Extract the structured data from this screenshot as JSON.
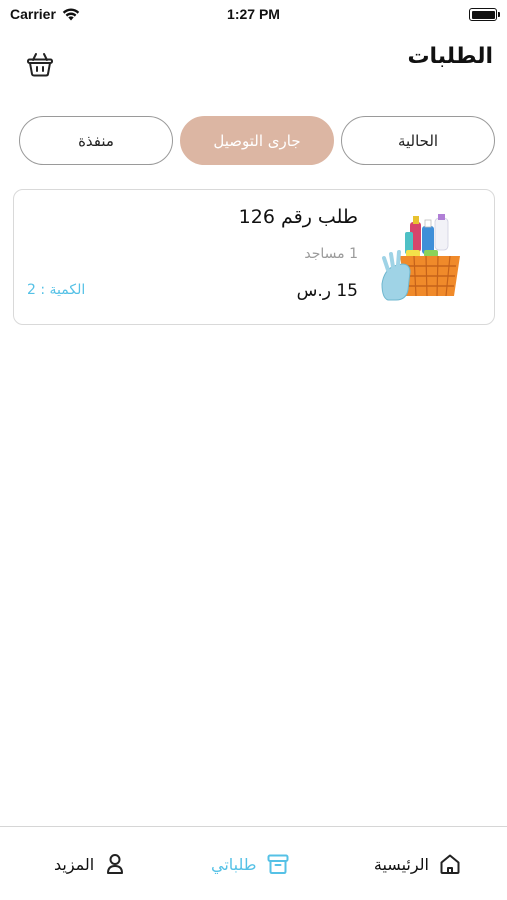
{
  "status_bar": {
    "carrier": "Carrier",
    "time": "1:27 PM"
  },
  "header": {
    "title": "الطلبات",
    "cart_icon": "basket-icon"
  },
  "tabs": [
    {
      "label": "الحالية",
      "active": false
    },
    {
      "label": "جارى التوصيل",
      "active": true
    },
    {
      "label": "منفذة",
      "active": false
    }
  ],
  "orders": [
    {
      "title": "طلب رقم 126",
      "category": "1 مساجد",
      "price": "15 ر.س",
      "quantity": "الكمية : 2",
      "image_icon": "cleaning-supplies-image"
    }
  ],
  "bottom_nav": {
    "home": {
      "label": "الرئيسية",
      "icon": "home-icon"
    },
    "orders": {
      "label": "طلباتي",
      "icon": "archive-box-icon"
    },
    "more": {
      "label": "المزيد",
      "icon": "user-icon"
    }
  },
  "colors": {
    "accent": "#55c1e6",
    "active_tab": "#dcb6a3",
    "muted_text": "#9b9b9b",
    "border": "#d9d9d9"
  }
}
